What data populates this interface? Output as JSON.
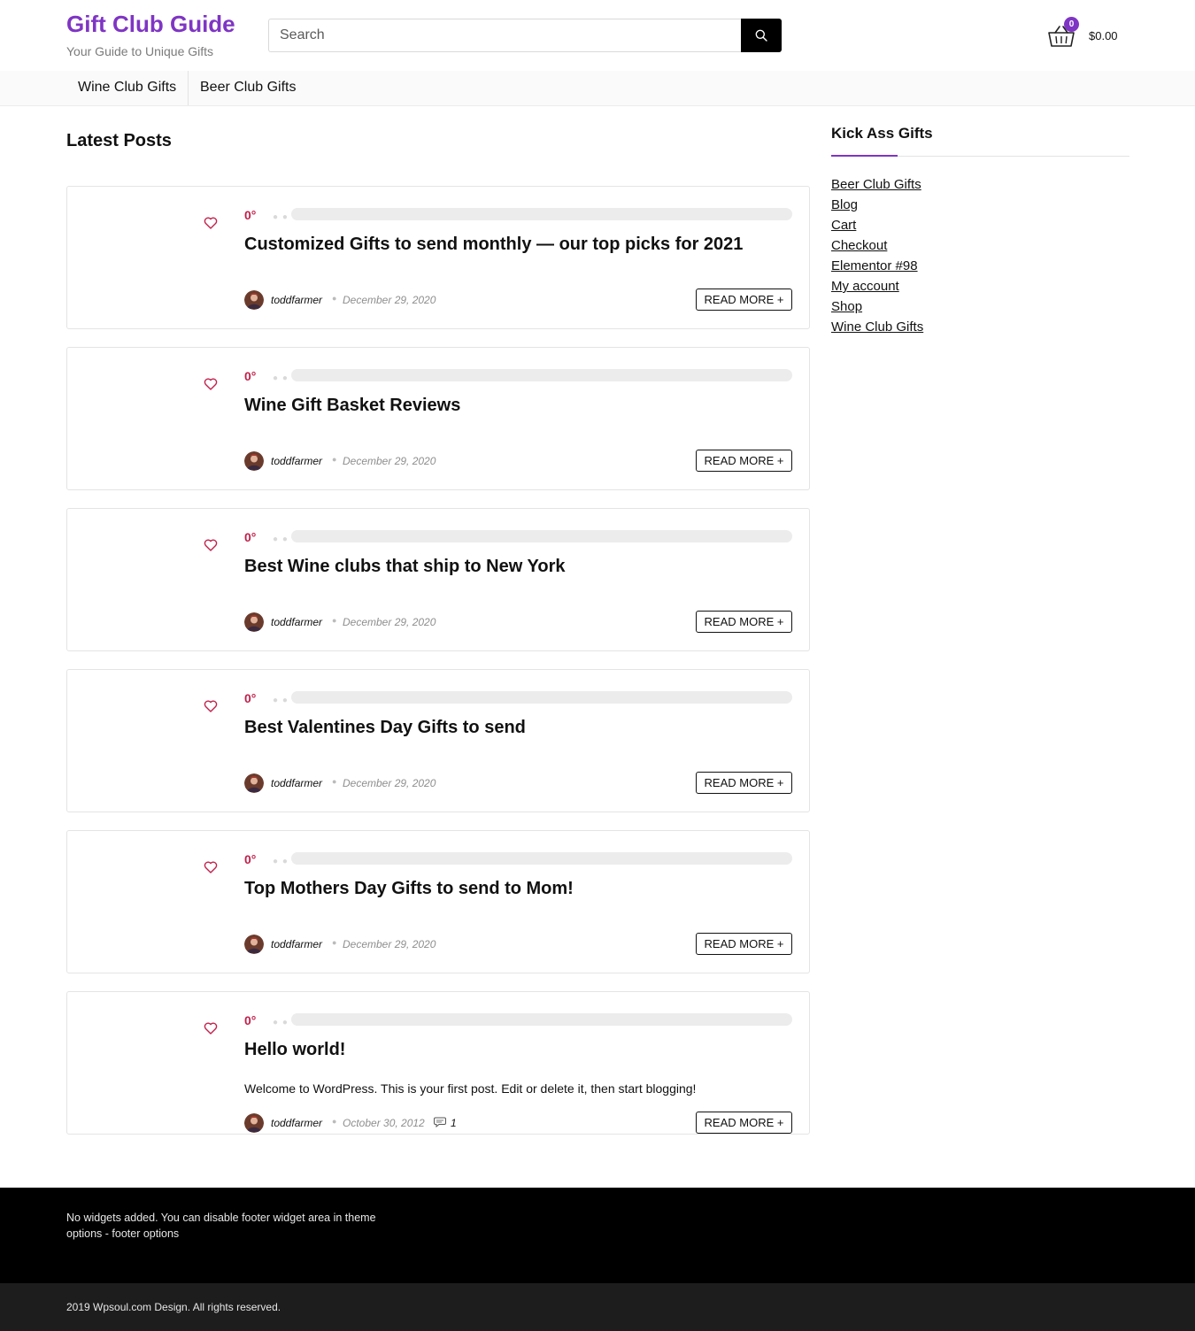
{
  "site": {
    "title": "Gift Club Guide",
    "tagline": "Your Guide to Unique Gifts",
    "accent_color": "#7f35c4"
  },
  "search": {
    "placeholder": "Search",
    "button_icon": "search-icon"
  },
  "cart": {
    "icon": "basket-icon",
    "count": "0",
    "total": "$0.00"
  },
  "nav": {
    "items": [
      {
        "label": "Wine Club Gifts"
      },
      {
        "label": "Beer Club Gifts"
      }
    ]
  },
  "main": {
    "heading": "Latest Posts",
    "read_more_label": "READ MORE +",
    "posts": [
      {
        "rating": "0°",
        "title": "Customized Gifts to send monthly — our top picks for 2021",
        "author": "toddfarmer",
        "date": "December 29, 2020",
        "excerpt": "",
        "comments": ""
      },
      {
        "rating": "0°",
        "title": "Wine Gift Basket Reviews",
        "author": "toddfarmer",
        "date": "December 29, 2020",
        "excerpt": "",
        "comments": ""
      },
      {
        "rating": "0°",
        "title": "Best Wine clubs that ship to New York",
        "author": "toddfarmer",
        "date": "December 29, 2020",
        "excerpt": "",
        "comments": ""
      },
      {
        "rating": "0°",
        "title": "Best Valentines Day Gifts to send",
        "author": "toddfarmer",
        "date": "December 29, 2020",
        "excerpt": "",
        "comments": ""
      },
      {
        "rating": "0°",
        "title": "Top Mothers Day Gifts to send to Mom!",
        "author": "toddfarmer",
        "date": "December 29, 2020",
        "excerpt": "",
        "comments": ""
      },
      {
        "rating": "0°",
        "title": "Hello world!",
        "author": "toddfarmer",
        "date": "October 30, 2012",
        "excerpt": "Welcome to WordPress. This is your first post. Edit or delete it, then start blogging!",
        "comments": "1"
      }
    ]
  },
  "sidebar": {
    "widget_title": "Kick Ass Gifts",
    "links": [
      {
        "label": "Beer Club Gifts"
      },
      {
        "label": "Blog"
      },
      {
        "label": "Cart"
      },
      {
        "label": "Checkout"
      },
      {
        "label": "Elementor #98"
      },
      {
        "label": "My account"
      },
      {
        "label": "Shop"
      },
      {
        "label": "Wine Club Gifts"
      }
    ]
  },
  "footer": {
    "widget_note": "No widgets added. You can disable footer widget area in theme options - footer options",
    "copyright": "2019 Wpsoul.com Design. All rights reserved."
  }
}
